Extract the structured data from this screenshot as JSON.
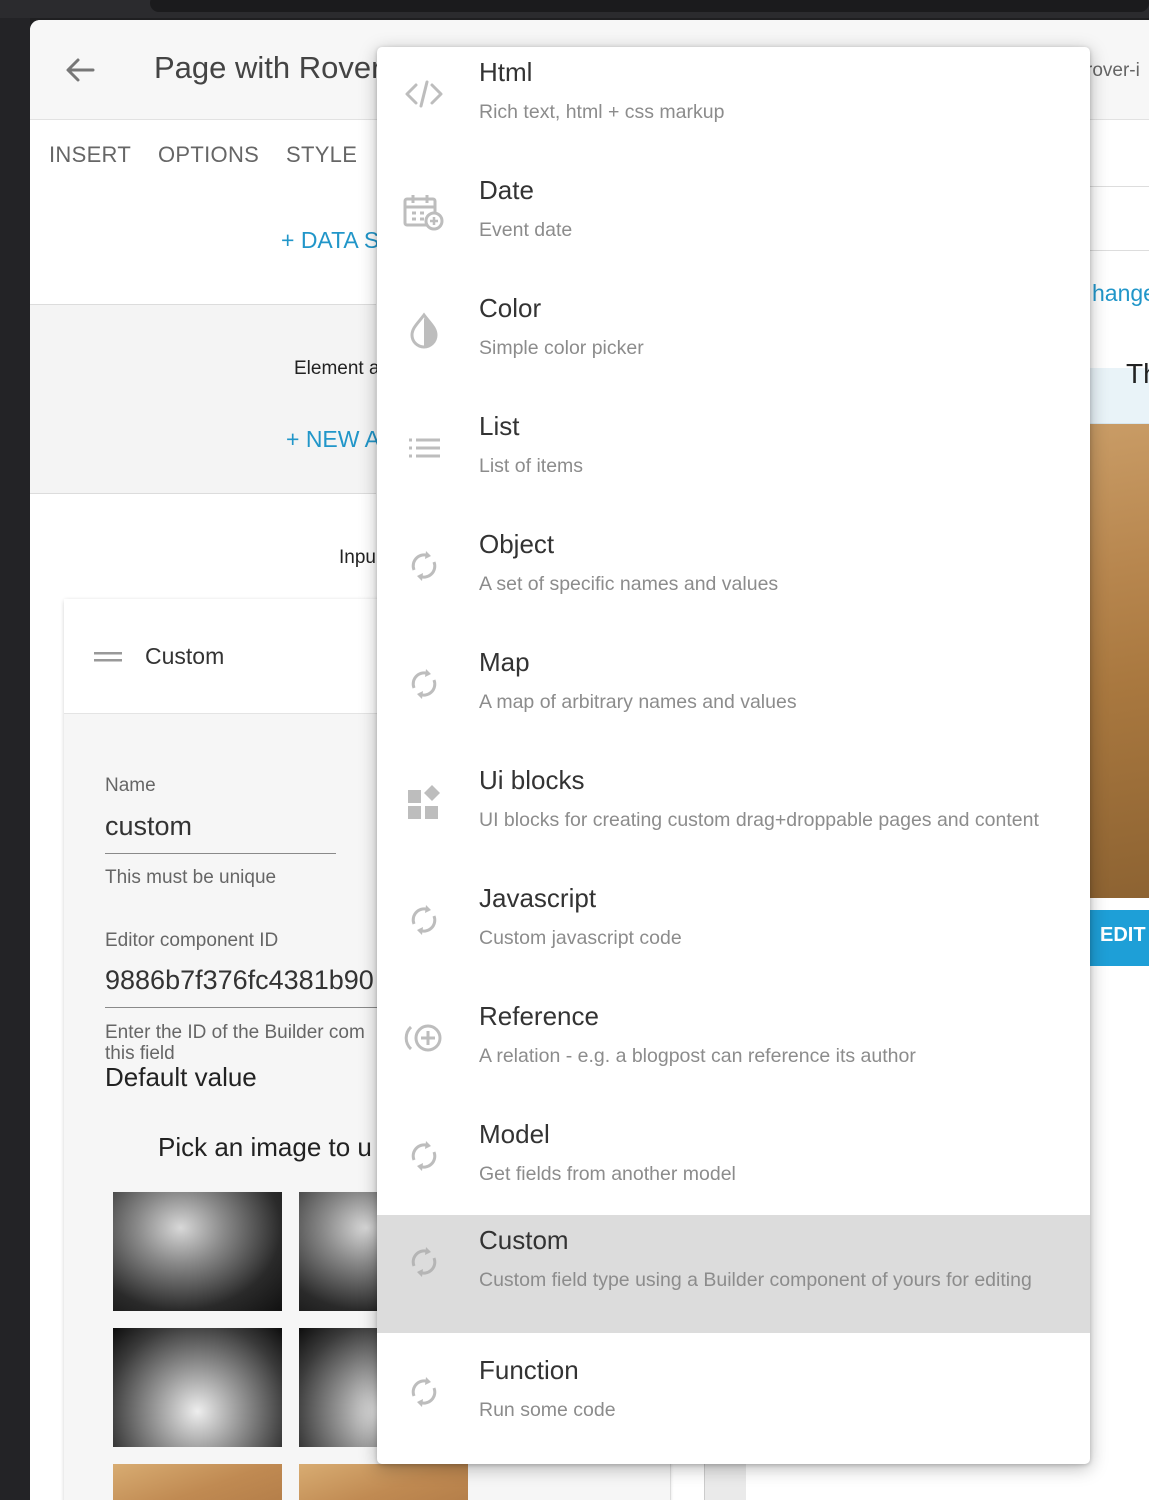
{
  "header": {
    "title": "Page with Rover",
    "url_fragment": "rover-i"
  },
  "tabs": [
    "INSERT",
    "OPTIONS",
    "STYLE"
  ],
  "data_link": "+ DATA S",
  "element_label": "Element a",
  "new_link": "+ NEW A",
  "inputs_label": "Inpu",
  "card": {
    "title": "Custom",
    "name_label": "Name",
    "name_value": "custom",
    "name_help": "This must be unique",
    "component_label": "Editor component ID",
    "component_value": "9886b7f376fc4381b90",
    "component_help_1": "Enter the ID of the Builder com",
    "component_help_2": "this field",
    "default_value": "Default value",
    "pick_label": "Pick an image to u"
  },
  "right_panel": {
    "change_link": "hange",
    "heading_frag": "Th",
    "edit_button": "EDIT"
  },
  "menu": {
    "items": [
      {
        "label": "Html",
        "desc": "Rich text, html + css markup",
        "icon": "code-icon"
      },
      {
        "label": "Date",
        "desc": "Event date",
        "icon": "calendar-add-icon"
      },
      {
        "label": "Color",
        "desc": "Simple color picker",
        "icon": "color-drop-icon"
      },
      {
        "label": "List",
        "desc": "List of items",
        "icon": "list-icon"
      },
      {
        "label": "Object",
        "desc": "A set of specific names and values",
        "icon": "sync-icon"
      },
      {
        "label": "Map",
        "desc": "A map of arbitrary names and values",
        "icon": "sync-icon"
      },
      {
        "label": "Ui blocks",
        "desc": "UI blocks for creating custom drag+droppable pages and content",
        "icon": "widgets-icon"
      },
      {
        "label": "Javascript",
        "desc": "Custom javascript code",
        "icon": "sync-icon"
      },
      {
        "label": "Reference",
        "desc": "A relation - e.g. a blogpost can reference its author",
        "icon": "reference-add-icon"
      },
      {
        "label": "Model",
        "desc": "Get fields from another model",
        "icon": "sync-icon"
      },
      {
        "label": "Custom",
        "desc": "Custom field type using a Builder component of yours for editing",
        "icon": "sync-icon",
        "selected": true
      },
      {
        "label": "Function",
        "desc": "Run some code",
        "icon": "sync-icon"
      }
    ]
  },
  "colors": {
    "accent": "#2196c9",
    "edit_button": "#1e9fd7",
    "selected_row": "#dcdcdc"
  }
}
